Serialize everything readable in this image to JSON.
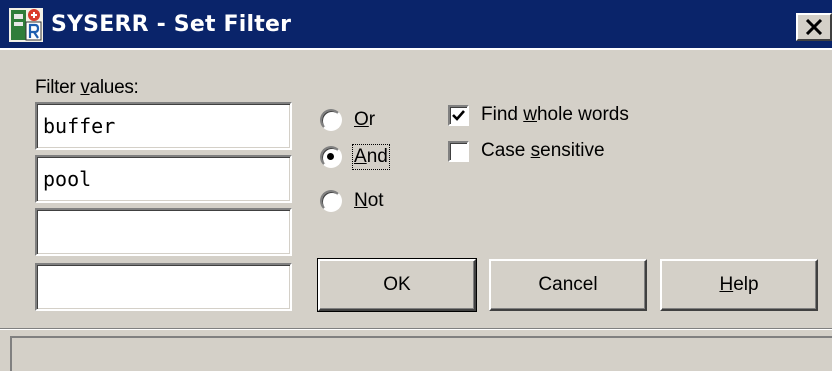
{
  "window": {
    "title": "SYSERR - Set Filter",
    "close_icon": "close-icon",
    "app_icon": "syserr-app-icon"
  },
  "filter": {
    "label_prefix": "Filter ",
    "label_access_key": "v",
    "label_rest": "alues:",
    "values": [
      "buffer",
      "pool",
      "",
      ""
    ]
  },
  "logic": {
    "options": [
      {
        "access_key": "O",
        "rest": "r",
        "selected": false
      },
      {
        "access_key": "A",
        "rest": "nd",
        "selected": true
      },
      {
        "access_key": "N",
        "rest": "ot",
        "selected": false
      }
    ]
  },
  "options": {
    "find_whole_words": {
      "prefix": "Find ",
      "access_key": "w",
      "rest": "hole words",
      "checked": true
    },
    "case_sensitive": {
      "prefix": "Case ",
      "access_key": "s",
      "rest": "ensitive",
      "checked": false
    }
  },
  "buttons": {
    "ok": "OK",
    "cancel": "Cancel",
    "help_access_key": "H",
    "help_rest": "elp"
  },
  "status": {
    "text": ""
  },
  "colors": {
    "titlebar": "#0a246a",
    "face": "#d4d0c8"
  }
}
